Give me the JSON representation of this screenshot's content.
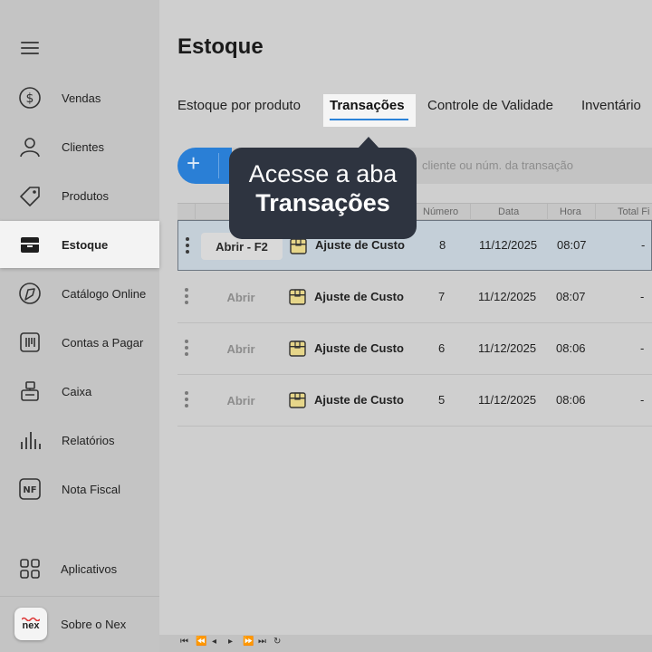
{
  "sidebar": {
    "menu_icon": "hamburger-icon",
    "items": [
      {
        "label": "Vendas",
        "icon": "dollar-circle-icon"
      },
      {
        "label": "Clientes",
        "icon": "user-icon"
      },
      {
        "label": "Produtos",
        "icon": "tag-icon"
      },
      {
        "label": "Estoque",
        "icon": "box-icon",
        "active": true
      },
      {
        "label": "Catálogo Online",
        "icon": "catalog-icon"
      },
      {
        "label": "Contas a Pagar",
        "icon": "bill-icon"
      },
      {
        "label": "Caixa",
        "icon": "cash-register-icon"
      },
      {
        "label": "Relatórios",
        "icon": "bar-chart-icon"
      },
      {
        "label": "Nota Fiscal",
        "icon": "nf-icon"
      },
      {
        "label": "Aplicativos",
        "icon": "apps-grid-icon"
      }
    ],
    "about": {
      "label": "Sobre o Nex",
      "logo_text": "nex"
    }
  },
  "main": {
    "title": "Estoque",
    "tabs": [
      "Estoque por produto",
      "Transações",
      "Controle de Validade",
      "Inventário"
    ],
    "active_tab": "Transações",
    "search_placeholder": "cliente ou núm. da transação",
    "tooltip": {
      "line1": "Acesse a aba",
      "line2": "Transações"
    },
    "columns": [
      "Número",
      "Data",
      "Hora",
      "Total Fi"
    ],
    "rows": [
      {
        "open_label": "Abrir - F2",
        "type": "Ajuste de Custo",
        "numero": "8",
        "data": "11/12/2025",
        "hora": "08:07",
        "total": "-",
        "selected": true
      },
      {
        "open_label": "Abrir",
        "type": "Ajuste de Custo",
        "numero": "7",
        "data": "11/12/2025",
        "hora": "08:07",
        "total": "-"
      },
      {
        "open_label": "Abrir",
        "type": "Ajuste de Custo",
        "numero": "6",
        "data": "11/12/2025",
        "hora": "08:06",
        "total": "-"
      },
      {
        "open_label": "Abrir",
        "type": "Ajuste de Custo",
        "numero": "5",
        "data": "11/12/2025",
        "hora": "08:06",
        "total": "-"
      }
    ],
    "pager_icons": [
      "first-page-icon",
      "prev-page-fast-icon",
      "prev-page-icon",
      "next-page-icon",
      "next-page-fast-icon",
      "last-page-icon",
      "refresh-icon"
    ]
  },
  "colors": {
    "accent": "#2a7fd6",
    "tooltip_bg": "#2e3440",
    "selected_row": "#c4cfd8"
  }
}
